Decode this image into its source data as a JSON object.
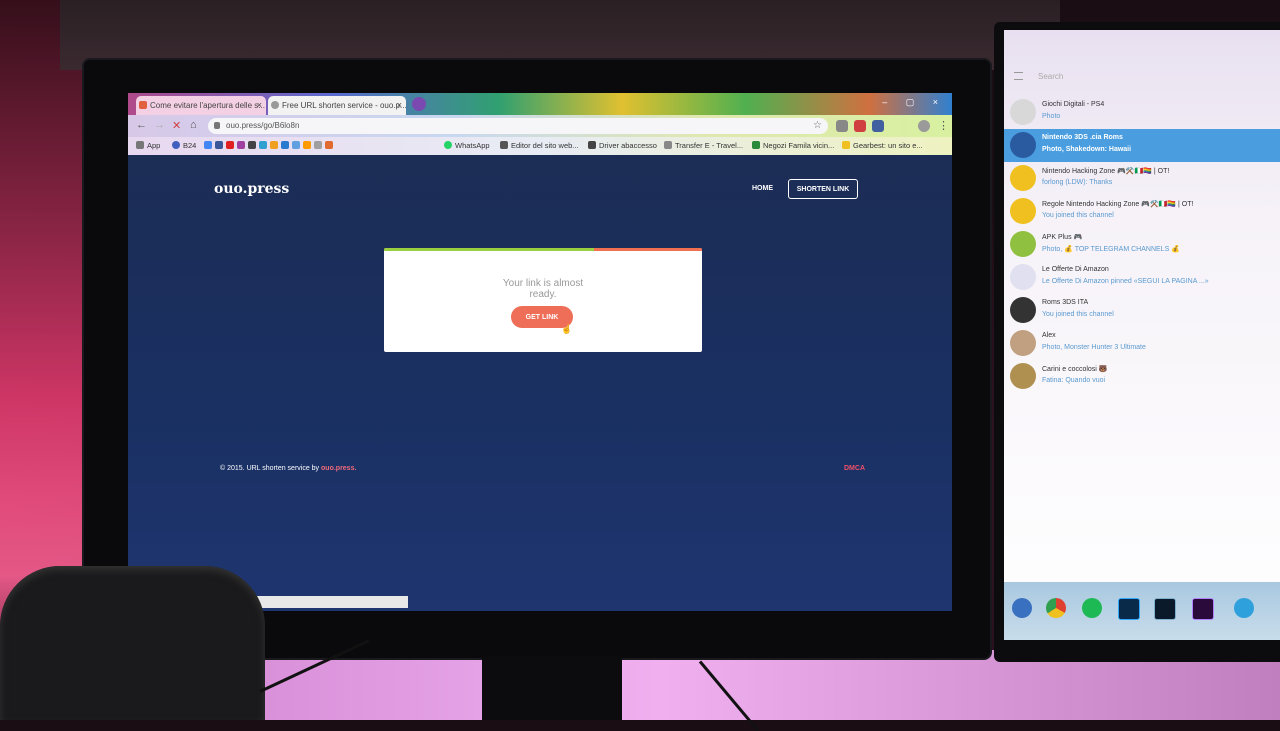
{
  "browser": {
    "tabs": [
      {
        "title": "Come evitare l'apertura delle s..."
      },
      {
        "title": "Free URL shorten service - ouo.p..."
      }
    ],
    "url": "ouo.press/go/B6lo8n",
    "bookmarks": [
      "App",
      "B24",
      "WhatsApp",
      "Editor del sito web...",
      "Driver abaccesso",
      "Transfer E - Travel...",
      "Negozi Famila vicin...",
      "Gearbest: un sito e..."
    ]
  },
  "site": {
    "brand": "ouo.press",
    "nav": {
      "home": "HOME",
      "shorten": "SHORTEN LINK"
    },
    "card": {
      "message": "Your link is almost ready.",
      "button": "GET LINK",
      "progress": 0.66
    },
    "footer": {
      "copyright": "© 2015. URL shorten service by",
      "brand": "ouo.press.",
      "dmca": "DMCA"
    }
  },
  "telegram": {
    "search_placeholder": "Search",
    "chats": [
      {
        "name": "Giochi Digitali - PS4",
        "preview": "Photo",
        "color": "#d8d8d8"
      },
      {
        "name": "Nintendo 3DS .cia Roms",
        "preview": "Photo, Shakedown: Hawaii",
        "color": "#2a5aa0",
        "active": true
      },
      {
        "name": "Nintendo Hacking Zone 🎮⚒️🇮🇹🏳️‍🌈 | OT!",
        "preview": "forlong (LDW): Thanks",
        "color": "#f0c020"
      },
      {
        "name": "Regole Nintendo Hacking Zone 🎮⚒️🇮🇹🏳️‍🌈 | OT!",
        "preview": "You joined this channel",
        "color": "#f0c020"
      },
      {
        "name": "APK Plus 🎮",
        "preview": "Photo, 💰 TOP TELEGRAM CHANNELS 💰",
        "color": "#90c040"
      },
      {
        "name": "Le Offerte Di Amazon",
        "preview": "Le Offerte Di Amazon pinned «SEGUI LA PAGINA ...»",
        "color": "#e0e0f0"
      },
      {
        "name": "Roms 3DS ITA",
        "preview": "You joined this channel",
        "color": "#333333"
      },
      {
        "name": "Alex",
        "preview": "Photo, Monster Hunter 3 Ultimate",
        "color": "#c0a080"
      },
      {
        "name": "Carini e coccolosi 🐻",
        "preview": "Fatina: Quando vuoi",
        "color": "#b09050"
      }
    ]
  }
}
